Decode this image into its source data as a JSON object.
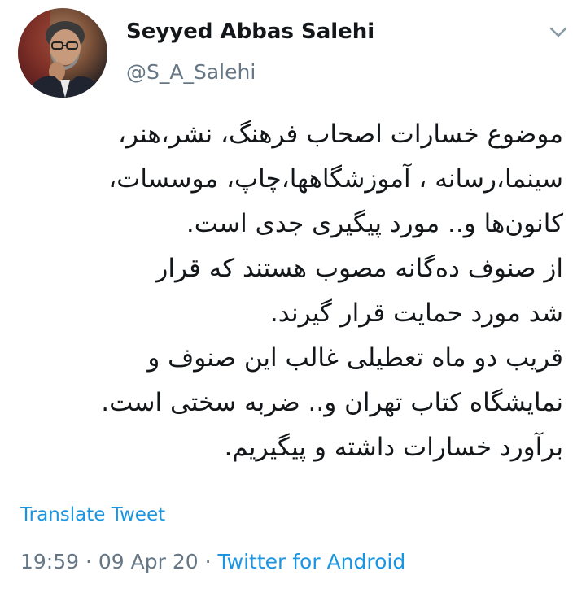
{
  "author": {
    "display_name": "Seyyed Abbas Salehi",
    "handle": "@S_A_Salehi"
  },
  "tweet": {
    "lines": [
      "موضوع خسارات اصحاب فرهنگ، نشر،هنر،",
      "سینما،رسانه ، آموزشگاهها،چاپ، موسسات،",
      "کانون‌ها و.. مورد پیگیری جدی است.",
      "از صنوف ده‌گانه مصوب هستند که قرار",
      "شد مورد حمایت قرار گیرند.",
      "قریب دو ماه تعطیلی غالب این صنوف و",
      "نمایشگاه کتاب تهران و.. ضربه سختی است.",
      "برآورد خسارات داشته و پیگیریم."
    ],
    "translate_label": "Translate Tweet",
    "time": "19:59",
    "separator1": " · ",
    "date": "09 Apr 20",
    "separator2": " · ",
    "source": "Twitter for Android"
  },
  "icons": {
    "menu": "chevron-down-icon",
    "avatar": "profile-photo"
  },
  "colors": {
    "link": "#1b95e0",
    "secondary": "#657786",
    "text": "#14171a"
  }
}
